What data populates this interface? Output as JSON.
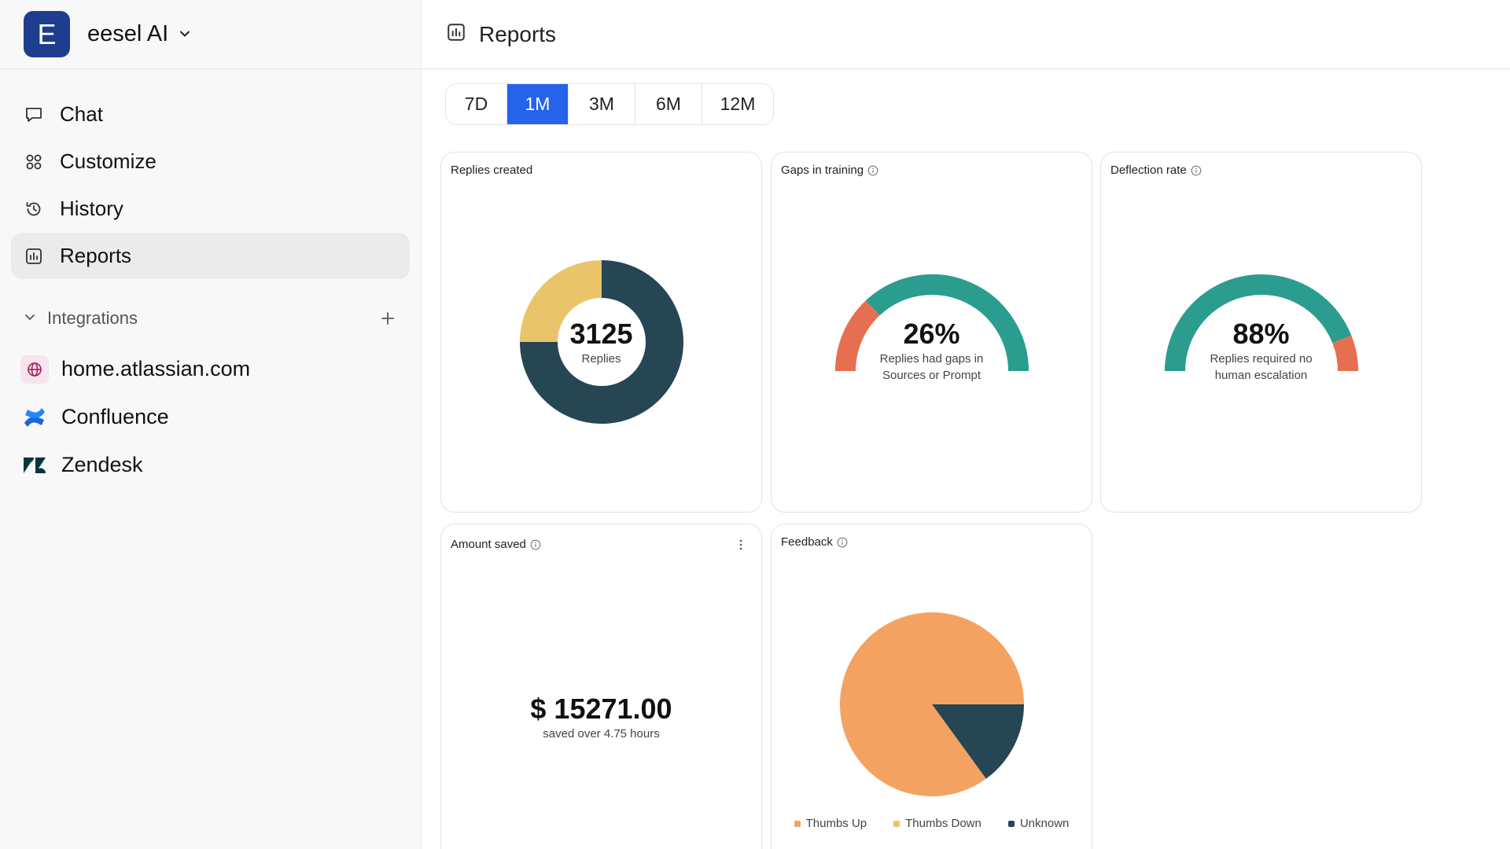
{
  "workspace": {
    "initial": "E",
    "name": "eesel AI"
  },
  "nav": {
    "items": [
      {
        "label": "Chat",
        "icon": "chat-bubble-icon",
        "active": false
      },
      {
        "label": "Customize",
        "icon": "grid-icon",
        "active": false
      },
      {
        "label": "History",
        "icon": "history-icon",
        "active": false
      },
      {
        "label": "Reports",
        "icon": "bar-chart-icon",
        "active": true
      }
    ]
  },
  "integrations": {
    "title": "Integrations",
    "items": [
      {
        "label": "home.atlassian.com",
        "icon": "globe-icon"
      },
      {
        "label": "Confluence",
        "icon": "confluence-icon"
      },
      {
        "label": "Zendesk",
        "icon": "zendesk-icon"
      }
    ]
  },
  "page": {
    "title": "Reports"
  },
  "ranges": {
    "options": [
      "7D",
      "1M",
      "3M",
      "6M",
      "12M"
    ],
    "selected": "1M"
  },
  "cards": {
    "replies": {
      "title": "Replies created",
      "value": "3125",
      "caption": "Replies"
    },
    "gaps": {
      "title": "Gaps in training",
      "value": "26%",
      "caption_line1": "Replies had gaps in",
      "caption_line2": "Sources or Prompt"
    },
    "deflection": {
      "title": "Deflection rate",
      "value": "88%",
      "caption_line1": "Replies required no",
      "caption_line2": "human escalation"
    },
    "amount": {
      "title": "Amount saved",
      "value": "$ 15271.00",
      "caption": "saved over 4.75 hours"
    },
    "feedback": {
      "title": "Feedback"
    }
  },
  "colors": {
    "accent": "#2563eb",
    "navy": "#264653",
    "gold": "#e9c46a",
    "teal": "#2a9d8f",
    "coral": "#e76f51",
    "orange": "#f4a261"
  },
  "chart_data": [
    {
      "type": "pie",
      "name": "replies-donut",
      "labels": [
        "",
        ""
      ],
      "values": [
        75,
        25
      ],
      "colors": [
        "#264653",
        "#e9c46a"
      ],
      "center_value": "3125",
      "center_label": "Replies"
    },
    {
      "type": "gauge",
      "name": "gaps-gauge",
      "value": 26,
      "max": 100,
      "colors": [
        "#e76f51",
        "#2a9d8f"
      ]
    },
    {
      "type": "gauge",
      "name": "deflection-gauge",
      "value": 88,
      "max": 100,
      "colors": [
        "#2a9d8f",
        "#e76f51"
      ]
    },
    {
      "type": "pie",
      "name": "feedback-pie",
      "labels": [
        "Thumbs Up",
        "Thumbs Down",
        "Unknown"
      ],
      "values": [
        85,
        0,
        15
      ],
      "colors": [
        "#f4a261",
        "#e9c46a",
        "#264653"
      ],
      "legend": "bottom"
    }
  ]
}
